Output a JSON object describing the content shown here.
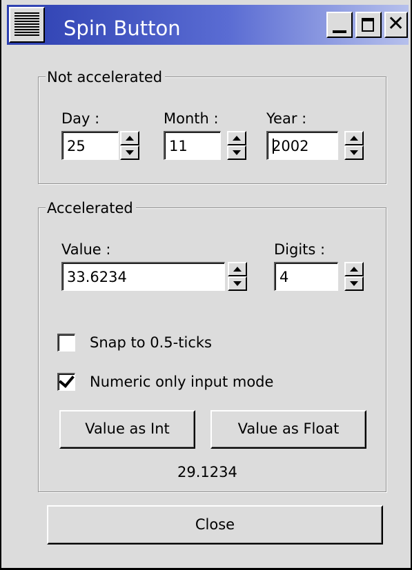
{
  "window": {
    "title": "Spin Button",
    "controls": {
      "menu_icon": "window-menu-icon",
      "minimize_icon": "minimize-icon",
      "maximize_icon": "maximize-icon",
      "close_icon": "close-icon",
      "close_glyph": "✕"
    }
  },
  "not_accelerated": {
    "label": "Not accelerated",
    "day": {
      "label": "Day :",
      "value": "25"
    },
    "month": {
      "label": "Month :",
      "value": "11"
    },
    "year": {
      "label": "Year :",
      "value": "2002"
    }
  },
  "accelerated": {
    "label": "Accelerated",
    "value_field": {
      "label": "Value :",
      "value": "33.6234"
    },
    "digits_field": {
      "label": "Digits :",
      "value": "4"
    },
    "snap_checkbox": {
      "label": "Snap to 0.5-ticks",
      "checked": false
    },
    "numeric_checkbox": {
      "label": "Numeric only input mode",
      "checked": true
    },
    "value_as_int_label": "Value as Int",
    "value_as_float_label": "Value as Float",
    "result": "29.1234"
  },
  "close_label": "Close",
  "colors": {
    "titlebar_start": "#2c3fb0",
    "titlebar_end": "#b6c0ec",
    "window_bg": "#dcdcdc"
  }
}
